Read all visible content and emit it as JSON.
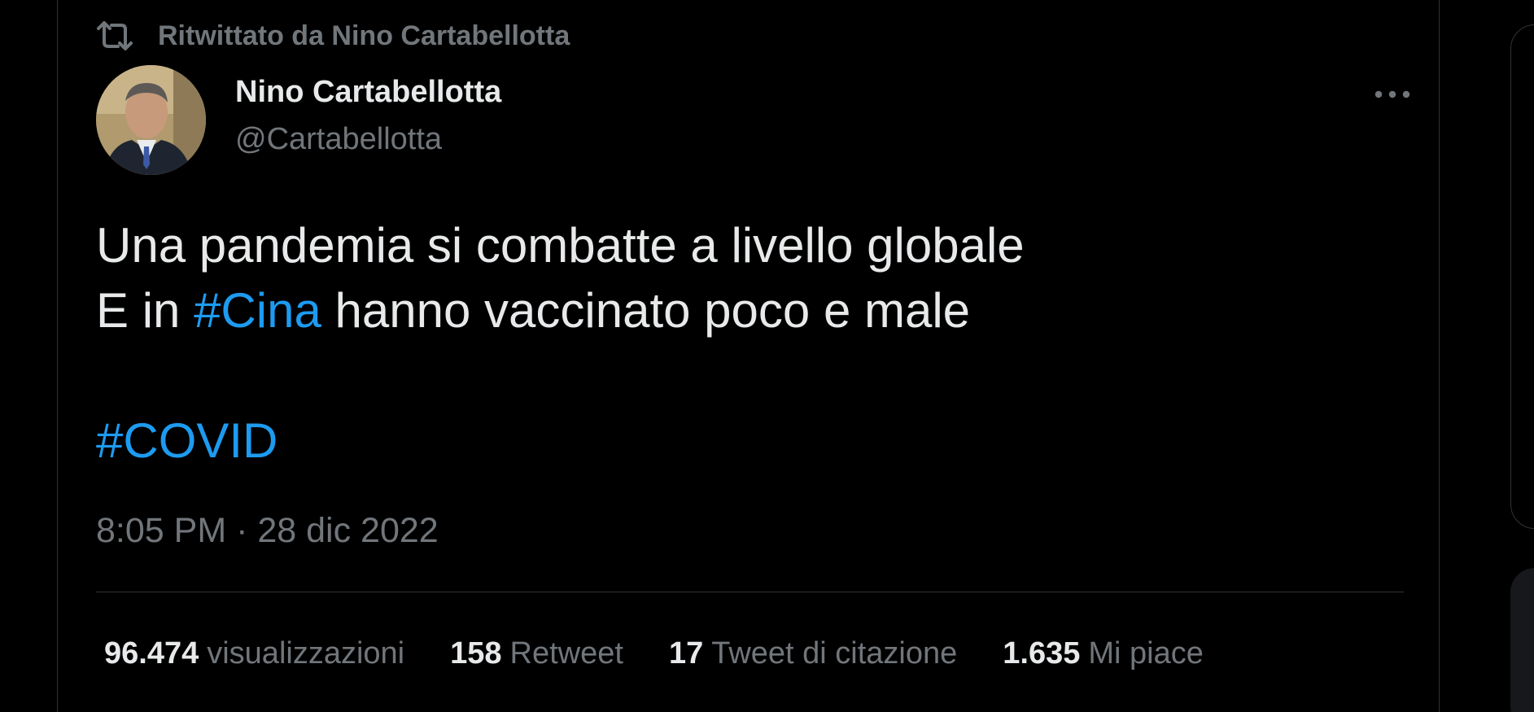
{
  "retweet": {
    "icon": "retweet-icon",
    "label": "Ritwittato da Nino Cartabellotta"
  },
  "author": {
    "name": "Nino Cartabellotta",
    "handle": "@Cartabellotta",
    "avatar": "avatar-photo"
  },
  "more": {
    "icon": "more-horizontal-icon"
  },
  "tweet": {
    "line1": "Una pandemia si combatte a livello globale",
    "line2_prefix": "E in ",
    "line2_hashtag": "#Cina",
    "line2_suffix": " hanno vaccinato poco e male",
    "hashtag2": "#COVID"
  },
  "timestamp": "8:05 PM · 28 dic 2022",
  "stats": {
    "views_count": "96.474",
    "views_label": "visualizzazioni",
    "retweets_count": "158",
    "retweets_label": "Retweet",
    "quotes_count": "17",
    "quotes_label": "Tweet di citazione",
    "likes_count": "1.635",
    "likes_label": "Mi piace"
  },
  "colors": {
    "background": "#000000",
    "text_primary": "#e7e9ea",
    "text_secondary": "#71767b",
    "accent": "#1d9bf0",
    "border": "#2f3336"
  }
}
